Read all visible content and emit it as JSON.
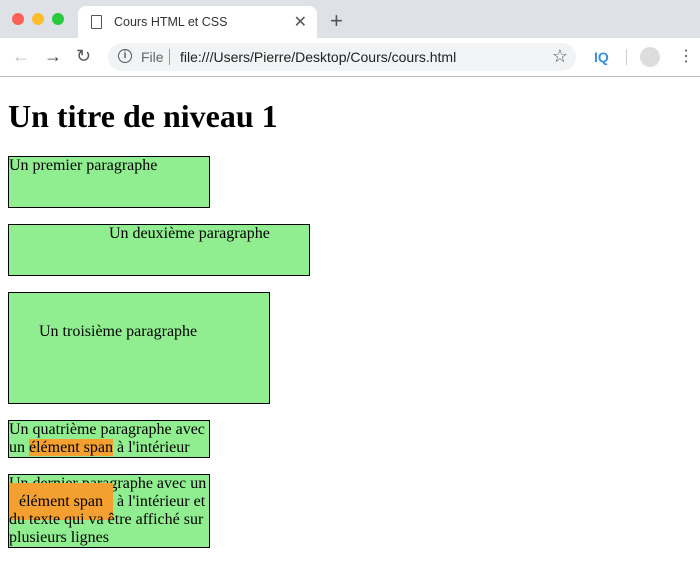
{
  "browser": {
    "tab_title": "Cours HTML et CSS",
    "url": "file:///Users/Pierre/Desktop/Cours/cours.html",
    "scheme_label": "File",
    "extension_label": "IQ"
  },
  "colors": {
    "paragraph_bg": "#90ee90",
    "span_bg": "#f4a030"
  },
  "page": {
    "h1": "Un titre de niveau 1",
    "p1": "Un premier paragraphe",
    "p2": "Un deuxième paragraphe",
    "p3": "Un troisième paragraphe",
    "p4_before": "Un quatrième paragraphe avec un ",
    "p4_span": "élément span",
    "p4_after": " à l'intérieur",
    "p5_before": "Un dernier paragraphe avec un ",
    "p5_span": "élément span",
    "p5_after": " à l'intérieur et du texte qui va être affiché sur plusieurs lignes"
  }
}
